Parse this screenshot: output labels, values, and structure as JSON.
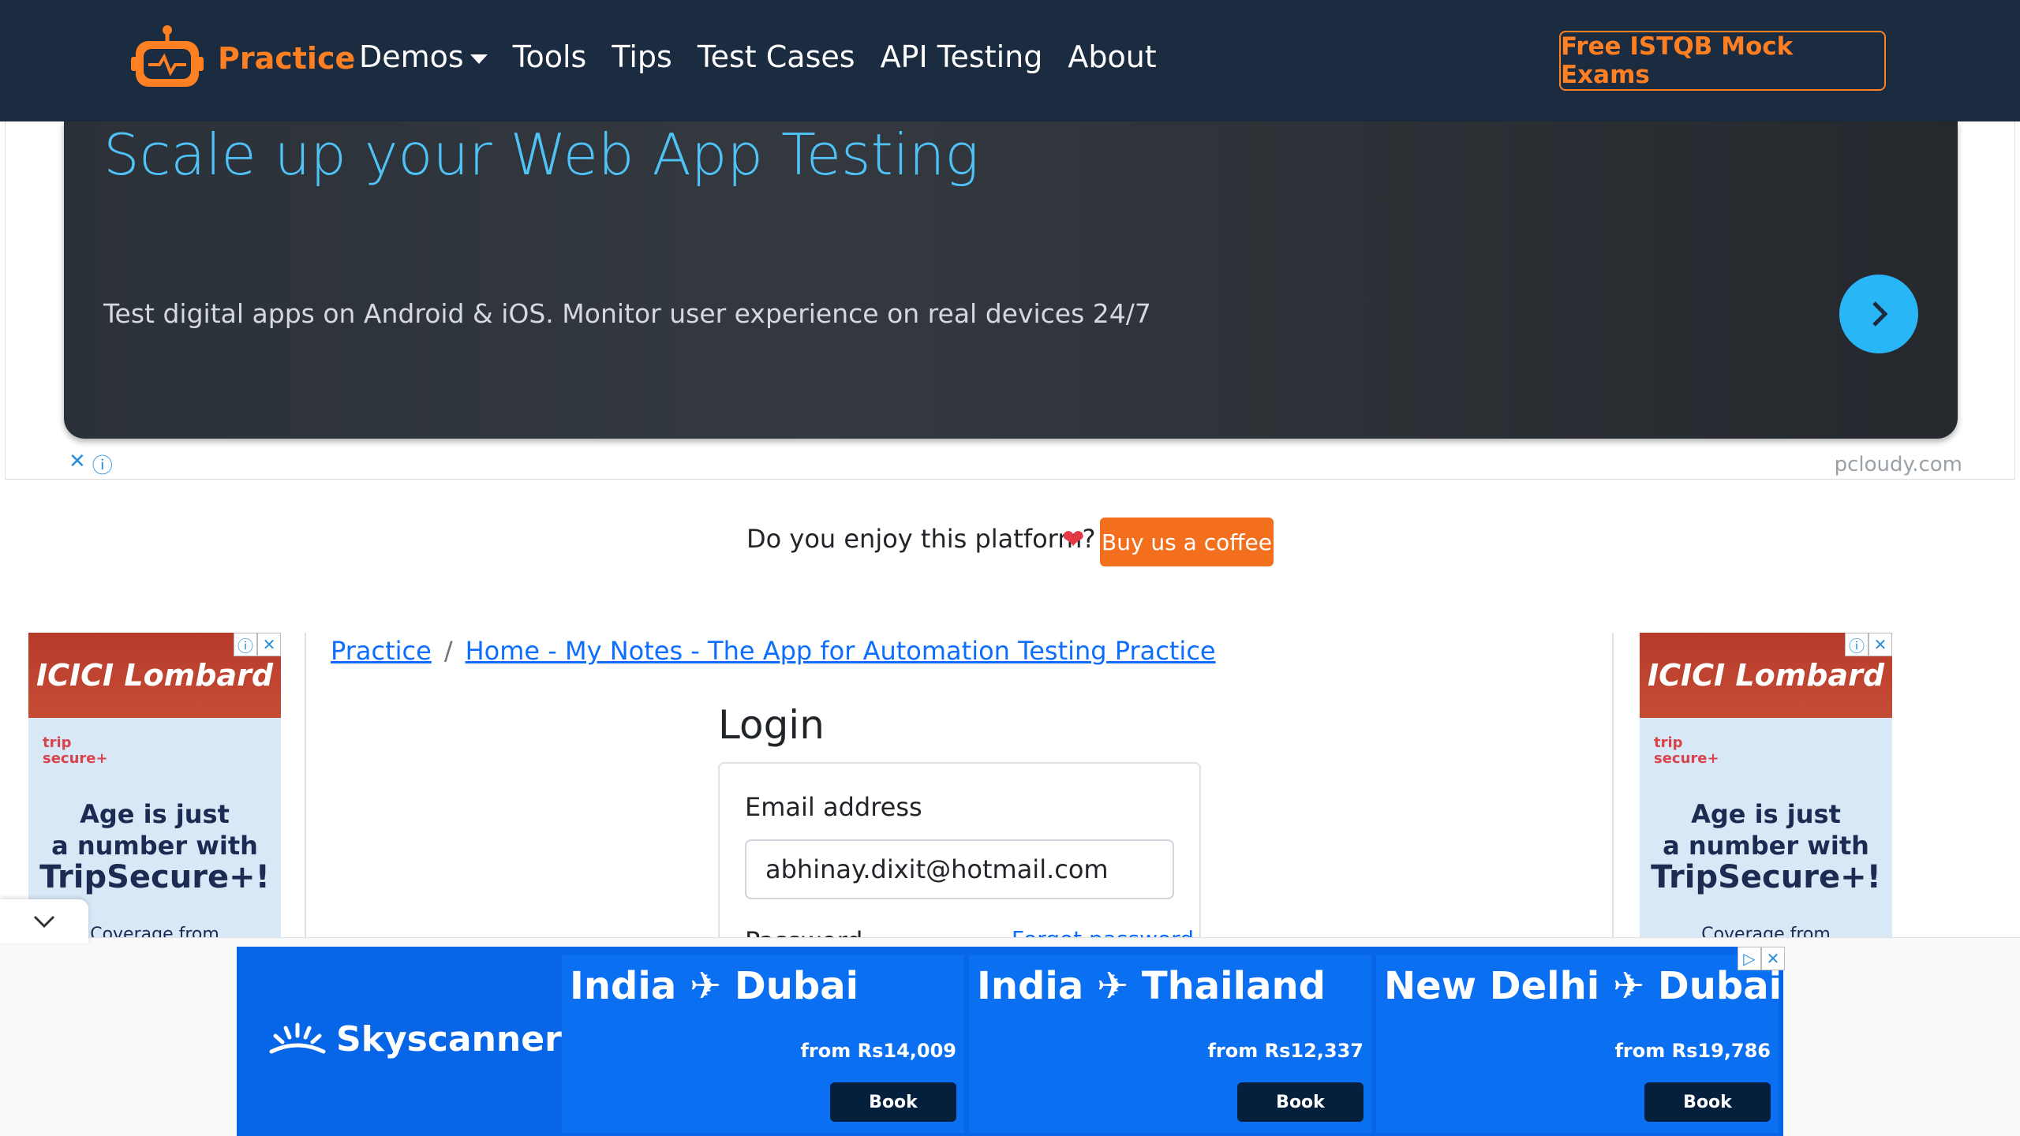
{
  "navbar": {
    "brand": "Practice",
    "links": [
      "Demos",
      "Tools",
      "Tips",
      "Test Cases",
      "API Testing",
      "About"
    ],
    "cta": "Free ISTQB Mock Exams"
  },
  "top_ad": {
    "headline": "Scale up your Web App Testing",
    "description": "Test digital apps on Android & iOS. Monitor user experience on real devices 24/7",
    "domain": "pcloudy.com",
    "close": "✕",
    "info": "ⓘ"
  },
  "support": {
    "text": "Do you enjoy this platform?",
    "heart": "❤",
    "button": "Buy us a coffee"
  },
  "side_ad": {
    "brand": "ICICI Lombard",
    "product_line1": "trip",
    "product_line2": "secure+",
    "msg_line1": "Age is just",
    "msg_line2": "a number with",
    "msg_line3": "TripSecure+!",
    "footer": "Coverage from"
  },
  "breadcrumb": {
    "root": "Practice",
    "separator": "/",
    "current": "Home - My Notes - The App for Automation Testing Practice"
  },
  "login": {
    "title": "Login",
    "email_label": "Email address",
    "email_value": "abhinay.dixit@hotmail.com",
    "password_label": "Password",
    "forgot": "Forgot password"
  },
  "sky_ad": {
    "brand": "Skyscanner",
    "cards": [
      {
        "route": "India ✈ Dubai",
        "price": "from Rs14,009",
        "book": "Book"
      },
      {
        "route": "India ✈ Thailand",
        "price": "from Rs12,337",
        "book": "Book"
      },
      {
        "route": "New Delhi ✈ Dubai",
        "price": "from Rs19,786",
        "book": "Book"
      }
    ]
  },
  "colors": {
    "navbar_bg": "#1b2b40",
    "accent": "#ff7f23",
    "link": "#0d6efd",
    "sky_blue": "#0765e8"
  }
}
